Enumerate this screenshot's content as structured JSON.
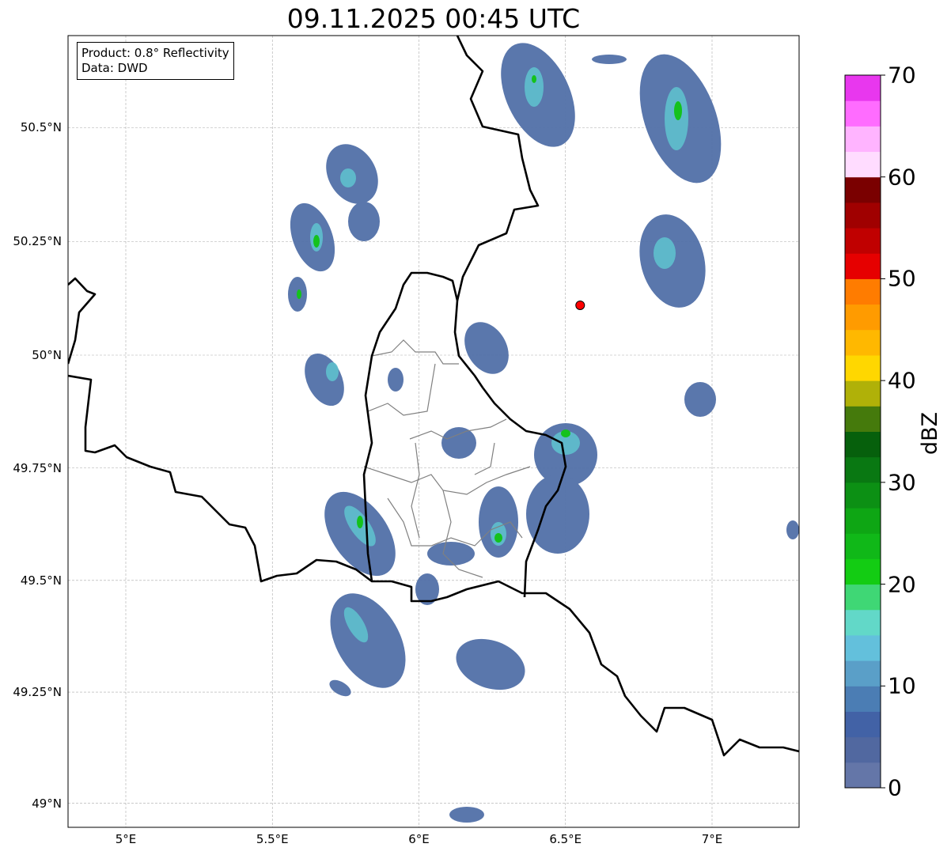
{
  "title": "09.11.2025 00:45 UTC",
  "info": {
    "product": "Product: 0.8° Reflectivity",
    "data": "Data: DWD"
  },
  "axes": {
    "lat_ticks": [
      {
        "label": "50.5°N",
        "lat": 50.5
      },
      {
        "label": "50.25°N",
        "lat": 50.25
      },
      {
        "label": "50°N",
        "lat": 50.0
      },
      {
        "label": "49.75°N",
        "lat": 49.75
      },
      {
        "label": "49.5°N",
        "lat": 49.5
      },
      {
        "label": "49.25°N",
        "lat": 49.25
      },
      {
        "label": "49°N",
        "lat": 49.0
      }
    ],
    "lon_ticks": [
      {
        "label": "5°E",
        "lon": 5.0
      },
      {
        "label": "5.5°E",
        "lon": 5.5
      },
      {
        "label": "6°E",
        "lon": 6.0
      },
      {
        "label": "6.5°E",
        "lon": 6.5
      },
      {
        "label": "7°E",
        "lon": 7.0
      }
    ],
    "lon_range": [
      4.8,
      7.3
    ],
    "lat_range": [
      48.95,
      50.7
    ]
  },
  "radar_site": {
    "lon": 6.55,
    "lat": 50.11,
    "color": "#ff0000"
  },
  "colorbar": {
    "label": "dBZ",
    "min": 0,
    "max": 70,
    "step": 2.5,
    "tick_labels": [
      "0",
      "10",
      "20",
      "30",
      "40",
      "50",
      "60",
      "70"
    ],
    "colors": [
      "#6476a8",
      "#5168a0",
      "#4262a6",
      "#4b7db4",
      "#5a9fc8",
      "#63c0dc",
      "#62d8c8",
      "#3fd775",
      "#13cc13",
      "#10b818",
      "#0ea614",
      "#0c9014",
      "#097812",
      "#06600c",
      "#457a0c",
      "#b0b108",
      "#ffd700",
      "#ffb800",
      "#ff9b00",
      "#ff7c00",
      "#e60000",
      "#c00000",
      "#a00000",
      "#7a0000",
      "#ffdcff",
      "#ffb4ff",
      "#ff6cff",
      "#e837ee"
    ]
  }
}
